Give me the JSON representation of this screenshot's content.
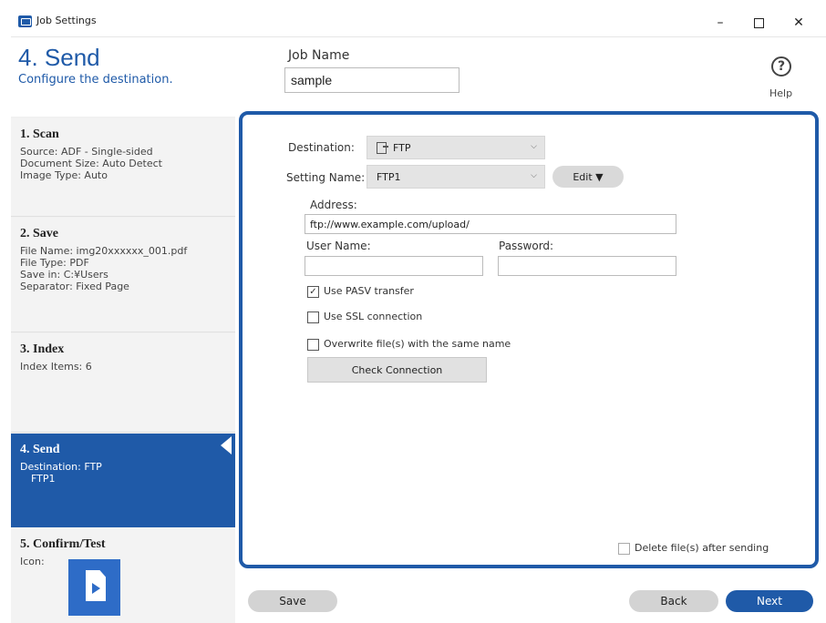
{
  "window": {
    "title": "Job Settings",
    "minimize_glyph": "–",
    "close_glyph": "✕"
  },
  "header": {
    "step_title": "4. Send",
    "step_subtitle": "Configure the destination.",
    "job_name_label": "Job Name",
    "job_name_value": "sample",
    "help_glyph": "?",
    "help_label": "Help"
  },
  "sidebar": {
    "scan": {
      "title": "1. Scan",
      "lines": [
        "Source: ADF - Single-sided",
        "Document Size: Auto Detect",
        "Image Type: Auto"
      ]
    },
    "save": {
      "title": "2. Save",
      "lines": [
        "File Name: img20xxxxxx_001.pdf",
        "File Type: PDF",
        "Save in: C:¥Users",
        "Separator: Fixed Page"
      ]
    },
    "index": {
      "title": "3. Index",
      "lines": [
        "Index Items: 6"
      ]
    },
    "send": {
      "title": "4. Send",
      "lines": [
        "Destination: FTP",
        "FTP1"
      ]
    },
    "confirm": {
      "title": "5. Confirm/Test",
      "icon_label": "Icon:"
    }
  },
  "main": {
    "destination_label": "Destination:",
    "destination_value": "FTP",
    "setting_name_label": "Setting Name:",
    "setting_name_value": "FTP1",
    "edit_label": "Edit ▼",
    "address_label": "Address:",
    "address_value": "ftp://www.example.com/upload/",
    "user_name_label": "User Name:",
    "user_name_value": "",
    "password_label": "Password:",
    "password_value": "",
    "use_pasv_label": "Use PASV transfer",
    "use_pasv_checked": true,
    "use_ssl_label": "Use SSL connection",
    "use_ssl_checked": false,
    "overwrite_label": "Overwrite file(s) with the same name",
    "overwrite_checked": false,
    "check_connection_label": "Check Connection",
    "delete_after_label": "Delete file(s) after sending",
    "delete_after_checked": false
  },
  "footer": {
    "save_label": "Save",
    "back_label": "Back",
    "next_label": "Next"
  },
  "colors": {
    "accent": "#1f5aa8"
  }
}
